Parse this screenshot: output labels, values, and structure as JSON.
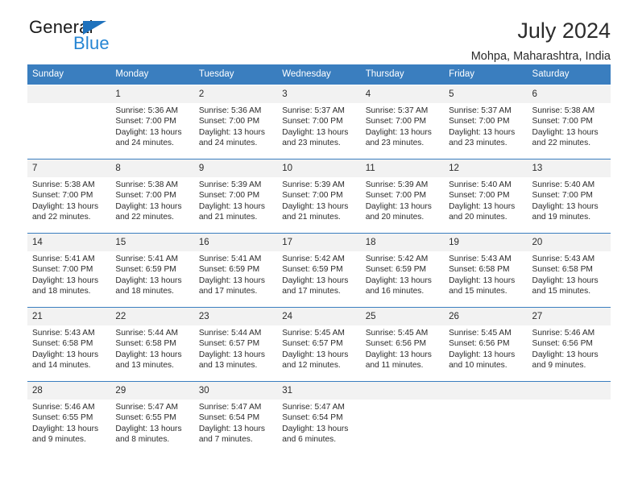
{
  "brand": {
    "name_top": "General",
    "name_bottom": "Blue",
    "flag_icon": "triangle-flag-icon",
    "color_dark": "#1a1a1a",
    "color_blue": "#2585d3",
    "flag_color": "#1f72bd"
  },
  "header": {
    "title": "July 2024",
    "subtitle": "Mohpa, Maharashtra, India"
  },
  "colors": {
    "header_band": "#3a7ebf",
    "daynum_band": "#f2f2f2",
    "text": "#2b2b2b"
  },
  "calendar": {
    "weekdays": [
      "Sunday",
      "Monday",
      "Tuesday",
      "Wednesday",
      "Thursday",
      "Friday",
      "Saturday"
    ],
    "weeks": [
      [
        {
          "day": "",
          "lines": []
        },
        {
          "day": "1",
          "lines": [
            "Sunrise: 5:36 AM",
            "Sunset: 7:00 PM",
            "Daylight: 13 hours",
            "and 24 minutes."
          ]
        },
        {
          "day": "2",
          "lines": [
            "Sunrise: 5:36 AM",
            "Sunset: 7:00 PM",
            "Daylight: 13 hours",
            "and 24 minutes."
          ]
        },
        {
          "day": "3",
          "lines": [
            "Sunrise: 5:37 AM",
            "Sunset: 7:00 PM",
            "Daylight: 13 hours",
            "and 23 minutes."
          ]
        },
        {
          "day": "4",
          "lines": [
            "Sunrise: 5:37 AM",
            "Sunset: 7:00 PM",
            "Daylight: 13 hours",
            "and 23 minutes."
          ]
        },
        {
          "day": "5",
          "lines": [
            "Sunrise: 5:37 AM",
            "Sunset: 7:00 PM",
            "Daylight: 13 hours",
            "and 23 minutes."
          ]
        },
        {
          "day": "6",
          "lines": [
            "Sunrise: 5:38 AM",
            "Sunset: 7:00 PM",
            "Daylight: 13 hours",
            "and 22 minutes."
          ]
        }
      ],
      [
        {
          "day": "7",
          "lines": [
            "Sunrise: 5:38 AM",
            "Sunset: 7:00 PM",
            "Daylight: 13 hours",
            "and 22 minutes."
          ]
        },
        {
          "day": "8",
          "lines": [
            "Sunrise: 5:38 AM",
            "Sunset: 7:00 PM",
            "Daylight: 13 hours",
            "and 22 minutes."
          ]
        },
        {
          "day": "9",
          "lines": [
            "Sunrise: 5:39 AM",
            "Sunset: 7:00 PM",
            "Daylight: 13 hours",
            "and 21 minutes."
          ]
        },
        {
          "day": "10",
          "lines": [
            "Sunrise: 5:39 AM",
            "Sunset: 7:00 PM",
            "Daylight: 13 hours",
            "and 21 minutes."
          ]
        },
        {
          "day": "11",
          "lines": [
            "Sunrise: 5:39 AM",
            "Sunset: 7:00 PM",
            "Daylight: 13 hours",
            "and 20 minutes."
          ]
        },
        {
          "day": "12",
          "lines": [
            "Sunrise: 5:40 AM",
            "Sunset: 7:00 PM",
            "Daylight: 13 hours",
            "and 20 minutes."
          ]
        },
        {
          "day": "13",
          "lines": [
            "Sunrise: 5:40 AM",
            "Sunset: 7:00 PM",
            "Daylight: 13 hours",
            "and 19 minutes."
          ]
        }
      ],
      [
        {
          "day": "14",
          "lines": [
            "Sunrise: 5:41 AM",
            "Sunset: 7:00 PM",
            "Daylight: 13 hours",
            "and 18 minutes."
          ]
        },
        {
          "day": "15",
          "lines": [
            "Sunrise: 5:41 AM",
            "Sunset: 6:59 PM",
            "Daylight: 13 hours",
            "and 18 minutes."
          ]
        },
        {
          "day": "16",
          "lines": [
            "Sunrise: 5:41 AM",
            "Sunset: 6:59 PM",
            "Daylight: 13 hours",
            "and 17 minutes."
          ]
        },
        {
          "day": "17",
          "lines": [
            "Sunrise: 5:42 AM",
            "Sunset: 6:59 PM",
            "Daylight: 13 hours",
            "and 17 minutes."
          ]
        },
        {
          "day": "18",
          "lines": [
            "Sunrise: 5:42 AM",
            "Sunset: 6:59 PM",
            "Daylight: 13 hours",
            "and 16 minutes."
          ]
        },
        {
          "day": "19",
          "lines": [
            "Sunrise: 5:43 AM",
            "Sunset: 6:58 PM",
            "Daylight: 13 hours",
            "and 15 minutes."
          ]
        },
        {
          "day": "20",
          "lines": [
            "Sunrise: 5:43 AM",
            "Sunset: 6:58 PM",
            "Daylight: 13 hours",
            "and 15 minutes."
          ]
        }
      ],
      [
        {
          "day": "21",
          "lines": [
            "Sunrise: 5:43 AM",
            "Sunset: 6:58 PM",
            "Daylight: 13 hours",
            "and 14 minutes."
          ]
        },
        {
          "day": "22",
          "lines": [
            "Sunrise: 5:44 AM",
            "Sunset: 6:58 PM",
            "Daylight: 13 hours",
            "and 13 minutes."
          ]
        },
        {
          "day": "23",
          "lines": [
            "Sunrise: 5:44 AM",
            "Sunset: 6:57 PM",
            "Daylight: 13 hours",
            "and 13 minutes."
          ]
        },
        {
          "day": "24",
          "lines": [
            "Sunrise: 5:45 AM",
            "Sunset: 6:57 PM",
            "Daylight: 13 hours",
            "and 12 minutes."
          ]
        },
        {
          "day": "25",
          "lines": [
            "Sunrise: 5:45 AM",
            "Sunset: 6:56 PM",
            "Daylight: 13 hours",
            "and 11 minutes."
          ]
        },
        {
          "day": "26",
          "lines": [
            "Sunrise: 5:45 AM",
            "Sunset: 6:56 PM",
            "Daylight: 13 hours",
            "and 10 minutes."
          ]
        },
        {
          "day": "27",
          "lines": [
            "Sunrise: 5:46 AM",
            "Sunset: 6:56 PM",
            "Daylight: 13 hours",
            "and 9 minutes."
          ]
        }
      ],
      [
        {
          "day": "28",
          "lines": [
            "Sunrise: 5:46 AM",
            "Sunset: 6:55 PM",
            "Daylight: 13 hours",
            "and 9 minutes."
          ]
        },
        {
          "day": "29",
          "lines": [
            "Sunrise: 5:47 AM",
            "Sunset: 6:55 PM",
            "Daylight: 13 hours",
            "and 8 minutes."
          ]
        },
        {
          "day": "30",
          "lines": [
            "Sunrise: 5:47 AM",
            "Sunset: 6:54 PM",
            "Daylight: 13 hours",
            "and 7 minutes."
          ]
        },
        {
          "day": "31",
          "lines": [
            "Sunrise: 5:47 AM",
            "Sunset: 6:54 PM",
            "Daylight: 13 hours",
            "and 6 minutes."
          ]
        },
        {
          "day": "",
          "lines": []
        },
        {
          "day": "",
          "lines": []
        },
        {
          "day": "",
          "lines": []
        }
      ]
    ]
  }
}
